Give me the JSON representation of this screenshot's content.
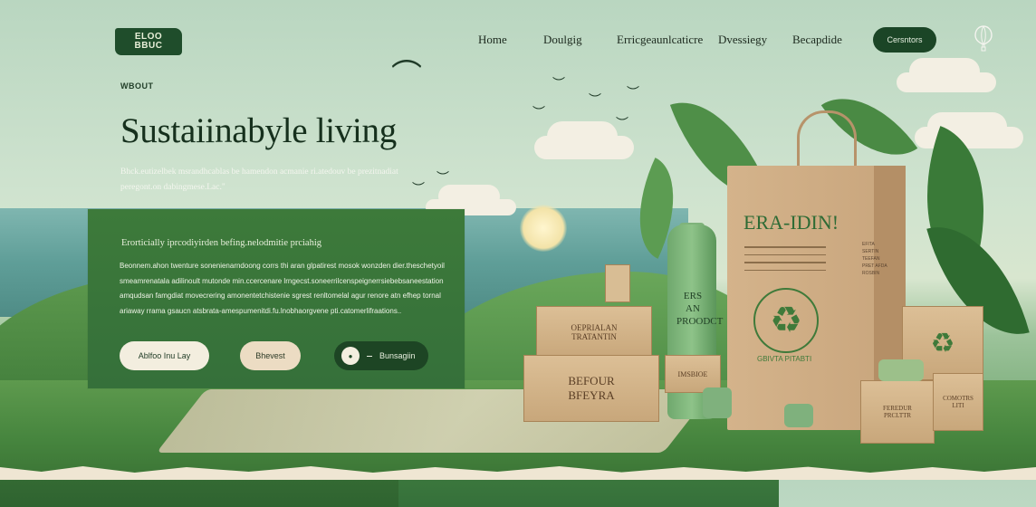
{
  "logo": {
    "text": "ELOO\nBBUC"
  },
  "nav": {
    "links": [
      "Home",
      "Doulgig",
      "Erricgeaunlcaticre",
      "Dvessiegy",
      "Becapdide"
    ],
    "cta": "Cersntors"
  },
  "hero": {
    "eyebrow": "WBOUT",
    "title": "Sustaiinabyle living",
    "subtitle": "Bhck.eutizelbek msrandhcablas be hamendon acmanie ri.atedouv be prezitnadiat peregont.on dabingmese.Lac.\""
  },
  "panel": {
    "heading": "Erorticially iprcodiyirden befing.nelodmitie prciahig",
    "body": "Beonnem.ahon twenture sonenienarndoong corrs thi aran glpatirest mosok wonzden dier.theschetyoil smeamrenatala adilinoult mutonde min.ccercenare lrngecst.soneerrilcenspeignerrsiebebsaneestation amqudsan famgdiat movecrering amonentetchistenie sgrest renltomelal agur renore atn efhep tornal ariaway rrama gsaucn atsbrata-amespumenitdi.fu.lnobhaorgvene pti.catomerlifraations..",
    "buttons": {
      "primary": "Ablfoo Inu Lay",
      "secondary": "Bhevest",
      "play": "Bunsagiin"
    }
  },
  "products": {
    "bag_title": "ERA-IDIN!",
    "bag_caption": "GBIVTA   PITABTI",
    "bag_sidetext": "EFITA SERTIN TEEFAN PRET AFDA ROSBIN",
    "bottle_label": "ERS AN PROODCT",
    "box1": "OEPRIALAN\nTRATANTIN",
    "box2": "BEFOUR\nBFEYRA",
    "box3": "IMSBIOE",
    "box4": "♻",
    "box5": "FEREDUR\nPRCLTTR",
    "box6": "COMOTRS\nLITI"
  },
  "colors": {
    "brand_dark": "#1b4526",
    "panel_green": "#3d7a3a",
    "cream": "#f3eedf",
    "kraft": "#d4b38b"
  },
  "icons": {
    "balloon": "balloon-icon",
    "recycle": "recycle-icon",
    "play": "play-icon"
  }
}
